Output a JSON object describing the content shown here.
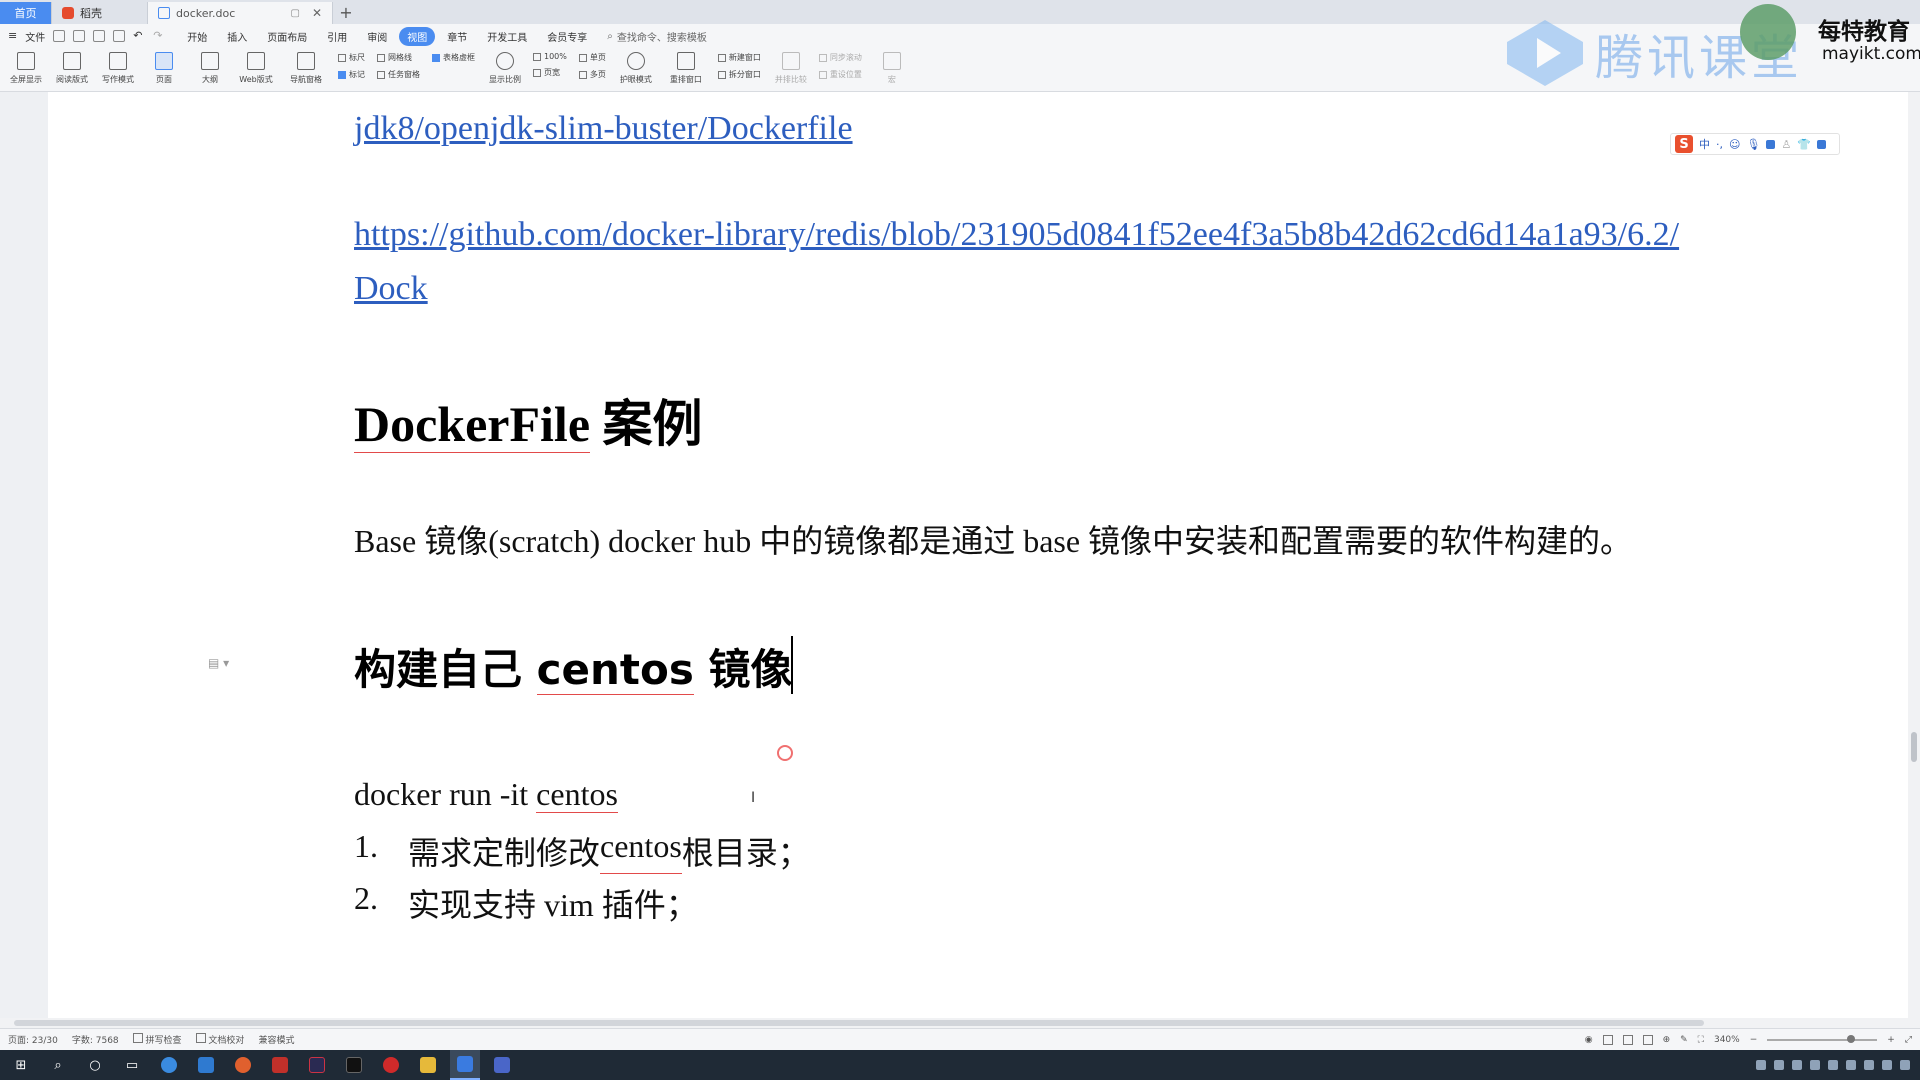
{
  "tabs": {
    "home": "首页",
    "app": "稻壳",
    "doc": "docker.doc"
  },
  "menu": {
    "file": "文件",
    "items": [
      "开始",
      "插入",
      "页面布局",
      "引用",
      "审阅",
      "视图",
      "章节",
      "开发工具",
      "会员专享"
    ],
    "active_index": 5,
    "search": "查找命令、搜索模板"
  },
  "ribbon": {
    "buttons": [
      "全屏显示",
      "阅读版式",
      "写作模式",
      "页面",
      "大纲",
      "Web版式",
      "导航窗格"
    ],
    "selected_index": 3,
    "checks_col1": [
      "标尺",
      "标记"
    ],
    "checks_col2": [
      "网格线",
      "任务窗格"
    ],
    "check_col3": "表格虚框",
    "zoom_btn": "显示比例",
    "zoom_100": "100%",
    "page_width": "页宽",
    "single": "单页",
    "multi": "多页",
    "eye": "护眼模式",
    "rearrange": "重排窗口",
    "new_window": "新建窗口",
    "split": "拆分窗口",
    "side_by_side": "并排比较",
    "sync_scroll": "同步滚动",
    "reset_pos": "重设位置",
    "macro": "宏"
  },
  "overlay": {
    "tencent": "腾讯课堂",
    "brand_title": "每特教育",
    "brand_sub": "mayikt.com"
  },
  "document": {
    "link1": "jdk8/openjdk-slim-buster/Dockerfile",
    "link2_line1": "https://github.com/docker-library/redis/blob/231905d0841f52ee4f3a5b8b42d62cd6d14a1a93/6.2/",
    "link2_line2": "Dock",
    "heading1_a": "DockerFile",
    "heading1_b": " 案例",
    "paragraph": "Base 镜像(scratch) docker hub 中的镜像都是通过 base 镜像中安装和配置需要的软件构建的。",
    "heading2_a": "构建自己 ",
    "heading2_b": "centos",
    "heading2_c": " 镜像",
    "command_a": "docker run -it ",
    "command_b": "centos",
    "list": [
      {
        "num": "1.",
        "a": "需求定制修改 ",
        "b": "centos",
        "c": " 根目录；"
      },
      {
        "num": "2.",
        "a": "实现支持 vim 插件；",
        "b": "",
        "c": ""
      }
    ]
  },
  "ime": {
    "logo": "S",
    "mode": "中"
  },
  "status": {
    "page": "页面: 23/30",
    "words": "字数: 7568",
    "spell": "拼写检查",
    "proof": "文档校对",
    "compat": "兼容模式",
    "zoom": "340%"
  },
  "colors": {
    "accent": "#4a8cf0",
    "link": "#2d5ebf",
    "taskbar": "#1f2a36"
  }
}
